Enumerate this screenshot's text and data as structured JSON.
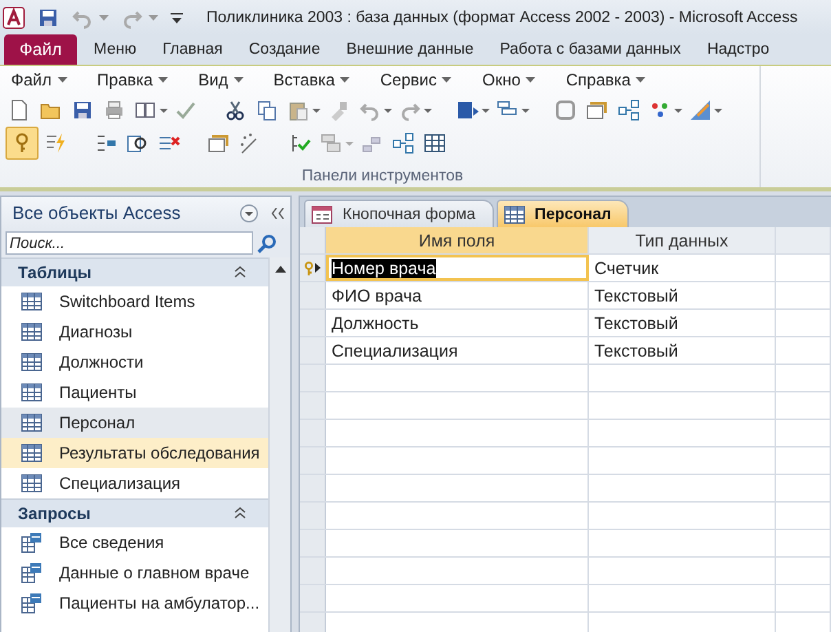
{
  "window": {
    "title": "Поликлиника 2003 : база данных (формат Access 2002 - 2003)  -  Microsoft Access"
  },
  "ribbon": {
    "file_button": "Файл",
    "tabs": [
      "Меню",
      "Главная",
      "Создание",
      "Внешние данные",
      "Работа с базами данных",
      "Надстро"
    ]
  },
  "menu_bar": [
    "Файл",
    "Правка",
    "Вид",
    "Вставка",
    "Сервис",
    "Окно",
    "Справка"
  ],
  "toolbar": {
    "group_label": "Панели инструментов",
    "primary_key_pressed": true
  },
  "navigation": {
    "title": "Все объекты Access",
    "search": {
      "placeholder": "Поиск..."
    },
    "groups": [
      {
        "title": "Таблицы",
        "kind": "table",
        "items": [
          {
            "label": "Switchboard Items",
            "selected": false,
            "hovered": false
          },
          {
            "label": "Диагнозы",
            "selected": false,
            "hovered": false
          },
          {
            "label": "Должности",
            "selected": false,
            "hovered": false
          },
          {
            "label": "Пациенты",
            "selected": false,
            "hovered": false
          },
          {
            "label": "Персонал",
            "selected": true,
            "hovered": false
          },
          {
            "label": "Результаты обследования",
            "selected": false,
            "hovered": true
          },
          {
            "label": "Специализация",
            "selected": false,
            "hovered": false
          }
        ]
      },
      {
        "title": "Запросы",
        "kind": "query",
        "items": [
          {
            "label": "Все сведения",
            "selected": false,
            "hovered": false
          },
          {
            "label": "Данные о главном враче",
            "selected": false,
            "hovered": false
          },
          {
            "label": "Пациенты на амбулатор...",
            "selected": false,
            "hovered": false
          }
        ]
      }
    ]
  },
  "document_tabs": [
    {
      "label": "Кнопочная форма",
      "kind": "form",
      "selected": false
    },
    {
      "label": "Персонал",
      "kind": "table",
      "selected": true
    }
  ],
  "grid": {
    "columns": [
      {
        "label": "Имя поля",
        "selected": true
      },
      {
        "label": "Тип данных",
        "selected": false
      }
    ],
    "rows": [
      {
        "field": "Номер врача",
        "type": "Счетчик",
        "primary_key": true,
        "current": true
      },
      {
        "field": "ФИО врача",
        "type": "Текстовый",
        "primary_key": false,
        "current": false
      },
      {
        "field": "Должность",
        "type": "Текстовый",
        "primary_key": false,
        "current": false
      },
      {
        "field": "Специализация",
        "type": "Текстовый",
        "primary_key": false,
        "current": false
      }
    ]
  }
}
